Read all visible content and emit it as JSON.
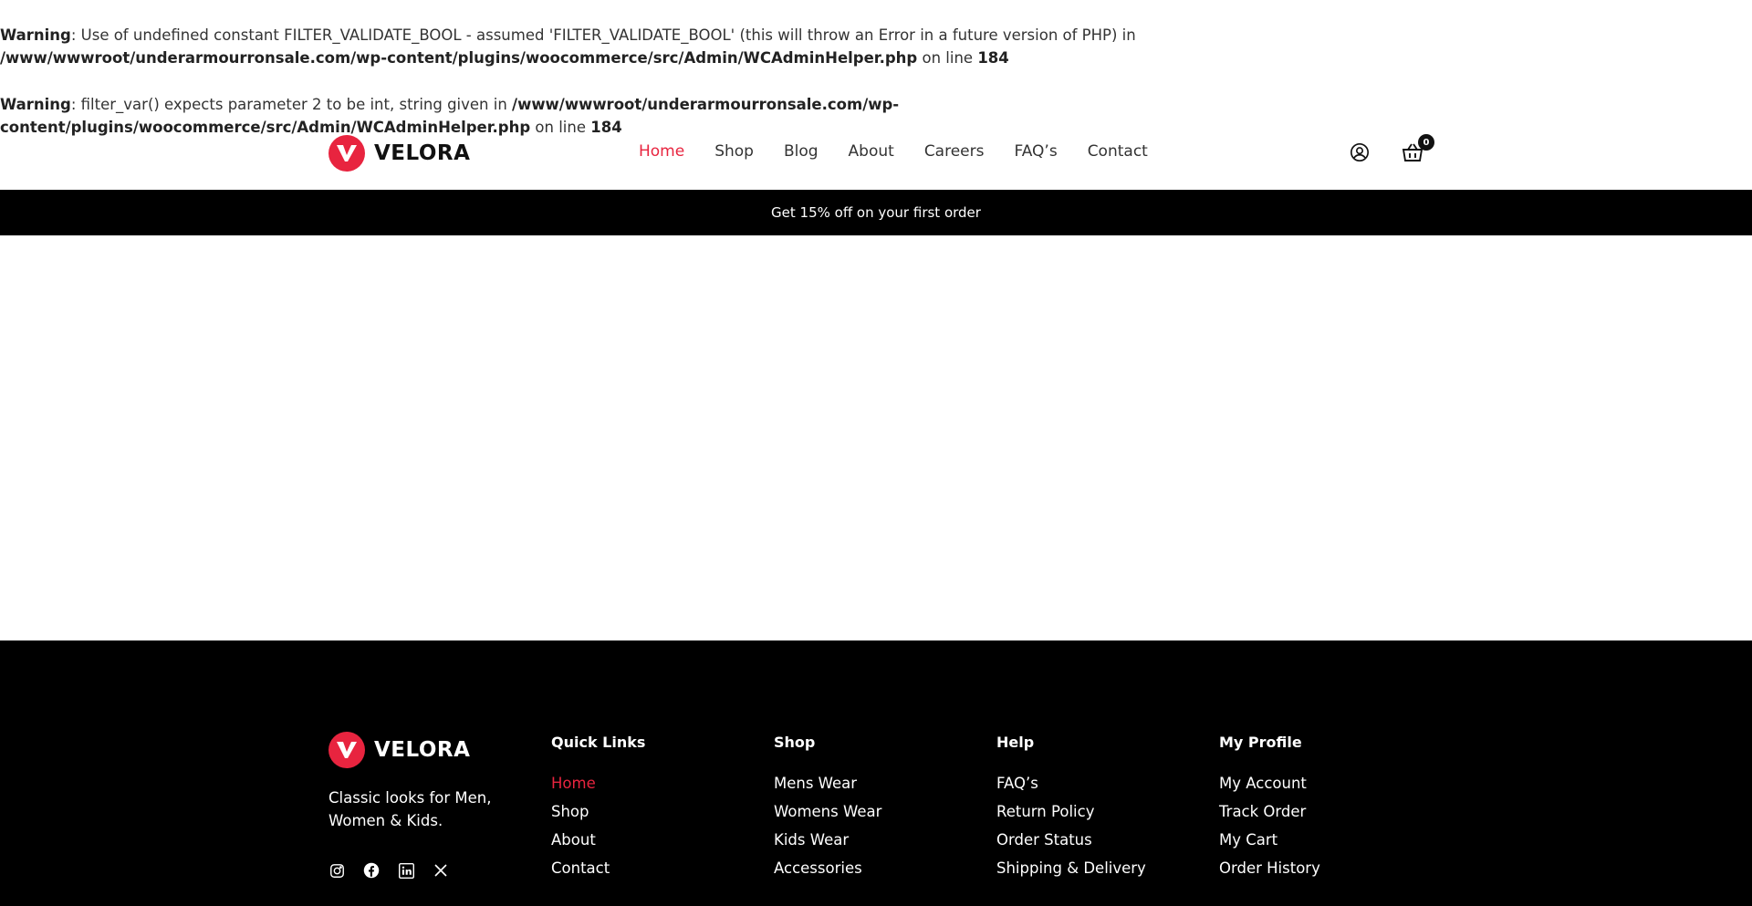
{
  "warnings": [
    {
      "label": "Warning",
      "message": ": Use of undefined constant FILTER_VALIDATE_BOOL - assumed 'FILTER_VALIDATE_BOOL' (this will throw an Error in a future version of PHP) in ",
      "path": "/www/wwwroot/underarmourronsale.com/wp-content/plugins/woocommerce/src/Admin/WCAdminHelper.php",
      "on_line": " on line ",
      "line": "184"
    },
    {
      "label": "Warning",
      "message": ": filter_var() expects parameter 2 to be int, string given in ",
      "path": "/www/wwwroot/underarmourronsale.com/wp-content/plugins/woocommerce/src/Admin/WCAdminHelper.php",
      "on_line": " on line ",
      "line": "184"
    }
  ],
  "brand": {
    "name": "VELORA",
    "accent_color": "#e8243f"
  },
  "nav": {
    "items": [
      {
        "label": "Home",
        "active": true
      },
      {
        "label": "Shop"
      },
      {
        "label": "Blog"
      },
      {
        "label": "About"
      },
      {
        "label": "Careers"
      },
      {
        "label": "FAQ’s"
      },
      {
        "label": "Contact"
      }
    ]
  },
  "header_icons": {
    "account_icon": "user-circle-icon",
    "cart_icon": "basket-icon",
    "cart_count": "0"
  },
  "promo": {
    "text": "Get 15% off on your first order"
  },
  "footer": {
    "tagline": "Classic looks for Men, Women & Kids.",
    "social": [
      "instagram-icon",
      "facebook-icon",
      "linkedin-icon",
      "x-icon"
    ],
    "columns": [
      {
        "title": "Quick Links",
        "links": [
          "Home",
          "Shop",
          "About",
          "Contact"
        ]
      },
      {
        "title": "Shop",
        "links": [
          "Mens Wear",
          "Womens Wear",
          "Kids Wear",
          "Accessories"
        ]
      },
      {
        "title": "Help",
        "links": [
          "FAQ’s",
          "Return Policy",
          "Order Status",
          "Shipping & Delivery"
        ]
      },
      {
        "title": "My Profile",
        "links": [
          "My Account",
          "Track Order",
          "My Cart",
          "Order History"
        ]
      }
    ]
  }
}
